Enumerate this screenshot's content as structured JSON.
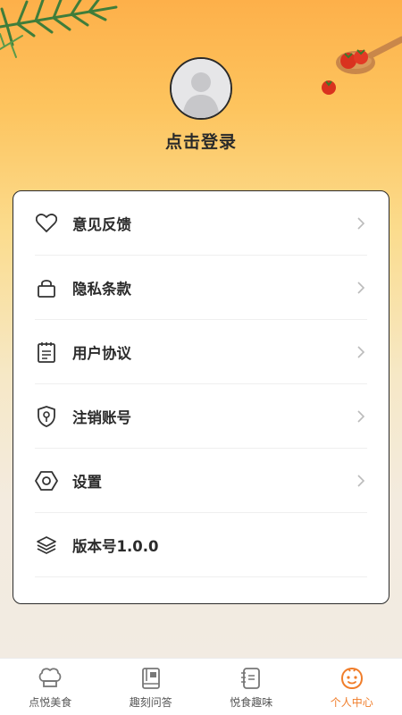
{
  "profile": {
    "login_label": "点击登录",
    "avatar_icon": "default-user-avatar"
  },
  "menu": {
    "items": [
      {
        "label": "意见反馈",
        "icon": "heart-icon",
        "has_arrow": true
      },
      {
        "label": "隐私条款",
        "icon": "lock-icon",
        "has_arrow": true
      },
      {
        "label": "用户协议",
        "icon": "document-icon",
        "has_arrow": true
      },
      {
        "label": "注销账号",
        "icon": "shield-key-icon",
        "has_arrow": true
      },
      {
        "label": "设置",
        "icon": "hexagon-settings-icon",
        "has_arrow": true
      },
      {
        "label": "版本号1.0.0",
        "icon": "layers-icon",
        "has_arrow": false
      }
    ]
  },
  "tabbar": {
    "tabs": [
      {
        "label": "点悦美食",
        "icon": "chef-hat-icon",
        "active": false
      },
      {
        "label": "趣刻问答",
        "icon": "book-icon",
        "active": false
      },
      {
        "label": "悦食趣味",
        "icon": "notebook-icon",
        "active": false
      },
      {
        "label": "个人中心",
        "icon": "smiley-face-icon",
        "active": true
      }
    ]
  },
  "colors": {
    "accent": "#f07d2a",
    "header_gradient_top": "#fdb04a",
    "text_primary": "#2b2b2b",
    "text_inactive": "#555555"
  }
}
